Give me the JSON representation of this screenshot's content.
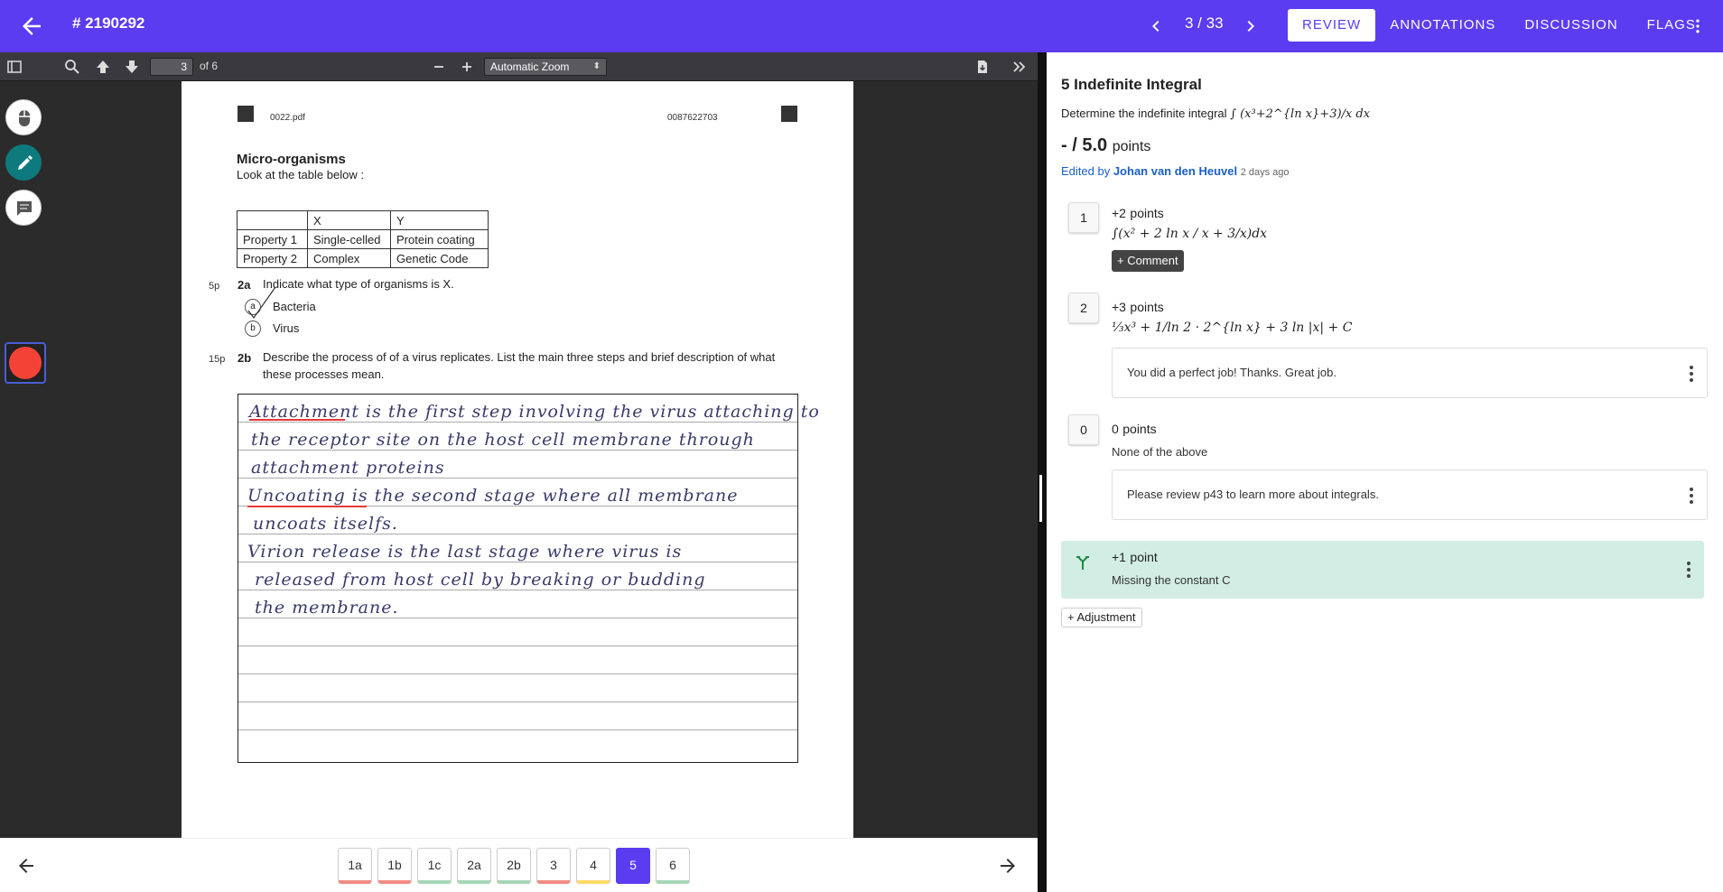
{
  "header": {
    "title": "# 2190292",
    "counter": "3 / 33",
    "tabs": [
      "REVIEW",
      "ANNOTATIONS",
      "DISCUSSION",
      "FLAGS"
    ]
  },
  "viewer": {
    "page_input": "3",
    "page_of": "of 6",
    "zoom": "Automatic Zoom"
  },
  "page": {
    "filename": "0022.pdf",
    "code": "0087622703",
    "title": "Micro-organisms",
    "subtitle": "Look at the table below :",
    "table": [
      [
        "",
        "X",
        "Y"
      ],
      [
        "Property 1",
        "Single-celled",
        "Protein coating"
      ],
      [
        "Property 2",
        "Complex",
        "Genetic Code"
      ]
    ],
    "q2a": {
      "points": "5p",
      "num": "2a",
      "text": "Indicate what type of organisms is X.",
      "options": [
        {
          "key": "a",
          "label": "Bacteria"
        },
        {
          "key": "b",
          "label": "Virus"
        }
      ]
    },
    "q2b": {
      "points": "15p",
      "num": "2b",
      "text": "Describe the process of of a virus replicates. List the main three steps and brief description of what these processes mean."
    },
    "handwriting": [
      "Attachment is the first step involving the virus attaching to",
      "the receptor site on the host cell membrane through",
      "attachment proteins",
      "Uncoating is the second stage where all membrane",
      "uncoats itselfs.",
      "Virion release is the last stage where virus is",
      "released from host cell by breaking or budding",
      "the membrane."
    ]
  },
  "question_nav": [
    {
      "label": "1a",
      "status": "#f28b82"
    },
    {
      "label": "1b",
      "status": "#f28b82"
    },
    {
      "label": "1c",
      "status": "#a5d6b5"
    },
    {
      "label": "2a",
      "status": "#a5d6b5"
    },
    {
      "label": "2b",
      "status": "#a5d6b5"
    },
    {
      "label": "3",
      "status": "#f28b82"
    },
    {
      "label": "4",
      "status": "#ffd966"
    },
    {
      "label": "5",
      "status": "#5b3cf0"
    },
    {
      "label": "6",
      "status": "#a5d6b5"
    }
  ],
  "panel": {
    "title": "5  Indefinite Integral",
    "desc": "Determine the indefinite integral",
    "desc_formula": "∫ (x³+2^{ln x}+3)/x dx",
    "points_score": "- / 5.0",
    "points_unit": "points",
    "edited_prefix": "Edited by",
    "edited_by": "Johan van den Heuvel",
    "edited_when": "2 days ago",
    "rubrics": [
      {
        "key": "1",
        "points": "+2",
        "unit": "points",
        "formula": "∫(x² + 2 ln x / x + 3/x)dx",
        "comment_btn": "+ Comment"
      },
      {
        "key": "2",
        "points": "+3",
        "unit": "points",
        "formula": "⅓x³ + 1/ln 2 · 2^{ln x} + 3 ln |x| + C",
        "feedback": "You did a perfect job! Thanks. Great job."
      },
      {
        "key": "0",
        "points": "0",
        "unit": "points",
        "desc": "None of the above",
        "feedback": "Please review p43 to learn more about integrals."
      }
    ],
    "adjustment": {
      "points": "+1",
      "unit": "point",
      "desc": "Missing the constant C"
    },
    "adjustment_btn": "+ Adjustment"
  },
  "colors": {
    "accent": "#5b3cf0",
    "teal": "#0e7a7d",
    "red": "#f44336",
    "adjust_bg": "#d2ede4"
  }
}
